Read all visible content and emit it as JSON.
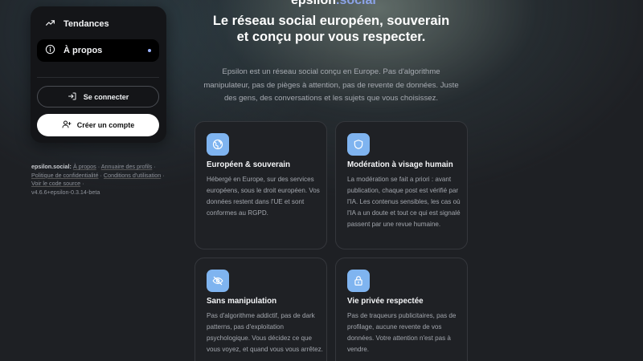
{
  "app": {
    "name_main": "epsilon",
    "name_tld": ".social"
  },
  "sidebar": {
    "items": [
      {
        "label": "Tendances",
        "icon": "trending-up-icon"
      },
      {
        "label": "À propos",
        "icon": "info-icon",
        "active": true
      }
    ],
    "login_label": "Se connecter",
    "create_label": "Créer un compte"
  },
  "footer": {
    "brand": "epsilon.social:",
    "links": {
      "about": "À propos",
      "directory": "Annuaire des profils",
      "privacy": "Politique de confidentialité",
      "terms": "Conditions d'utilisation",
      "source": "Voir le code source"
    },
    "sep": "·",
    "version": "v4.6.6+epsilon-0.3.14-beta"
  },
  "hero": {
    "title": "Le réseau social européen, souverain et conçu pour vous respecter.",
    "description": "Epsilon est un réseau social conçu en Europe. Pas d'algorithme manipulateur, pas de pièges à attention, pas de revente de données. Juste des gens, des conversations et les sujets que vous choisissez."
  },
  "features": [
    {
      "icon": "globe-icon",
      "title": "Européen & souverain",
      "text": "Hébergé en Europe, sur des services européens, sous le droit européen. Vos données restent dans l'UE et sont conformes au RGPD."
    },
    {
      "icon": "shield-icon",
      "title": "Modération à visage humain",
      "text": "La modération se fait a priori : avant publication, chaque post est vérifié par l'IA. Les contenus sensibles, les cas où l'IA a un doute et tout ce qui est signalé passent par une revue humaine."
    },
    {
      "icon": "eye-off-icon",
      "title": "Sans manipulation",
      "text": "Pas d'algorithme addictif, pas de dark patterns, pas d'exploitation psychologique. Vous décidez ce que vous voyez, et quand vous vous arrêtez."
    },
    {
      "icon": "lock-icon",
      "title": "Vie privée respectée",
      "text": "Pas de traqueurs publicitaires, pas de profilage, aucune revente de vos données. Votre attention n'est pas à vendre."
    }
  ],
  "colors": {
    "accent": "#7fb4f0",
    "background": "#1e2024",
    "card": "#1f2125",
    "sidebar": "#141518"
  }
}
